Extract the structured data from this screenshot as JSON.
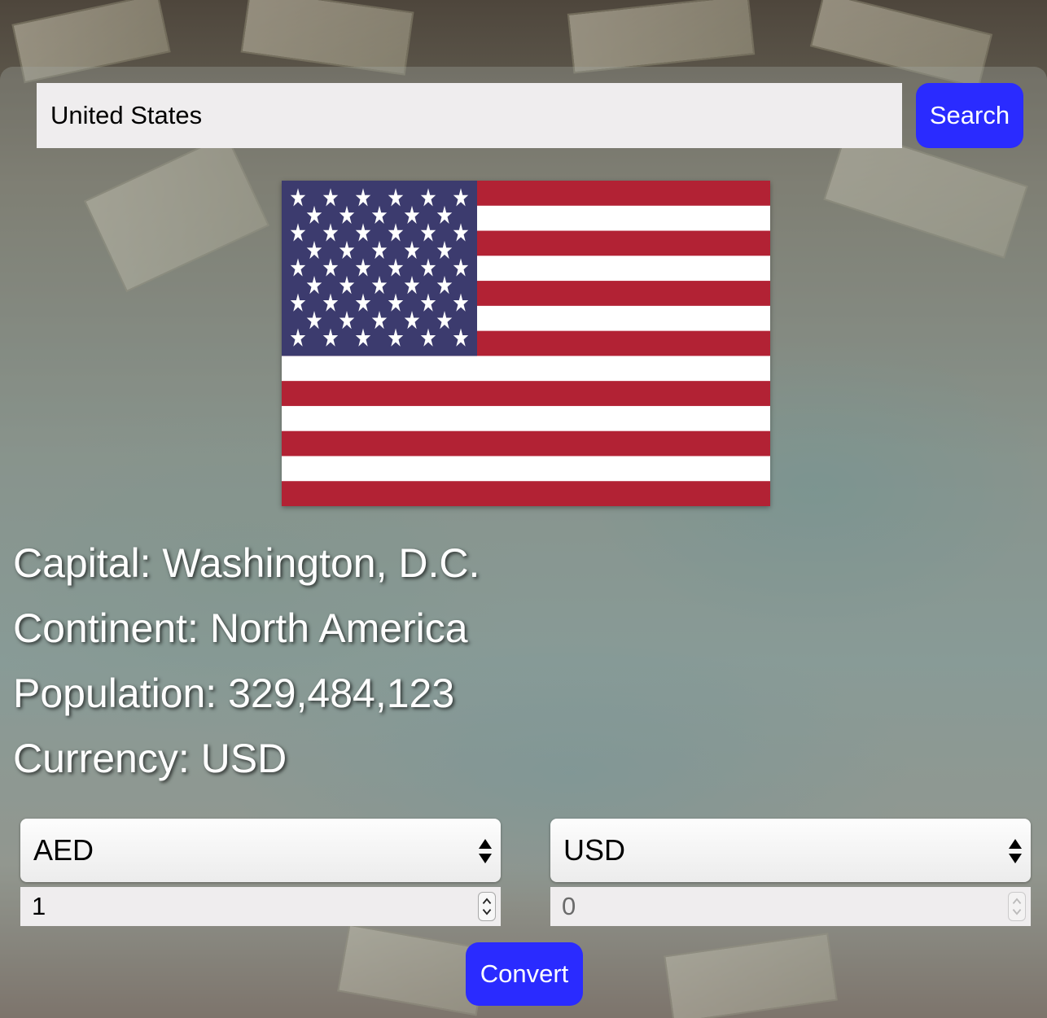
{
  "search": {
    "value": "United States",
    "button_label": "Search"
  },
  "country": {
    "capital": "Capital: Washington, D.C.",
    "continent": "Continent: North America",
    "population": "Population: 329,484,123",
    "currency": "Currency: USD",
    "flag_icon": "us-flag-image"
  },
  "converter": {
    "from_currency": "AED",
    "to_currency": "USD",
    "from_amount": "1",
    "to_amount": "0",
    "convert_label": "Convert"
  },
  "colors": {
    "accent": "#2a2bff",
    "flag_red": "#b22234",
    "flag_blue": "#3c3b6e"
  }
}
